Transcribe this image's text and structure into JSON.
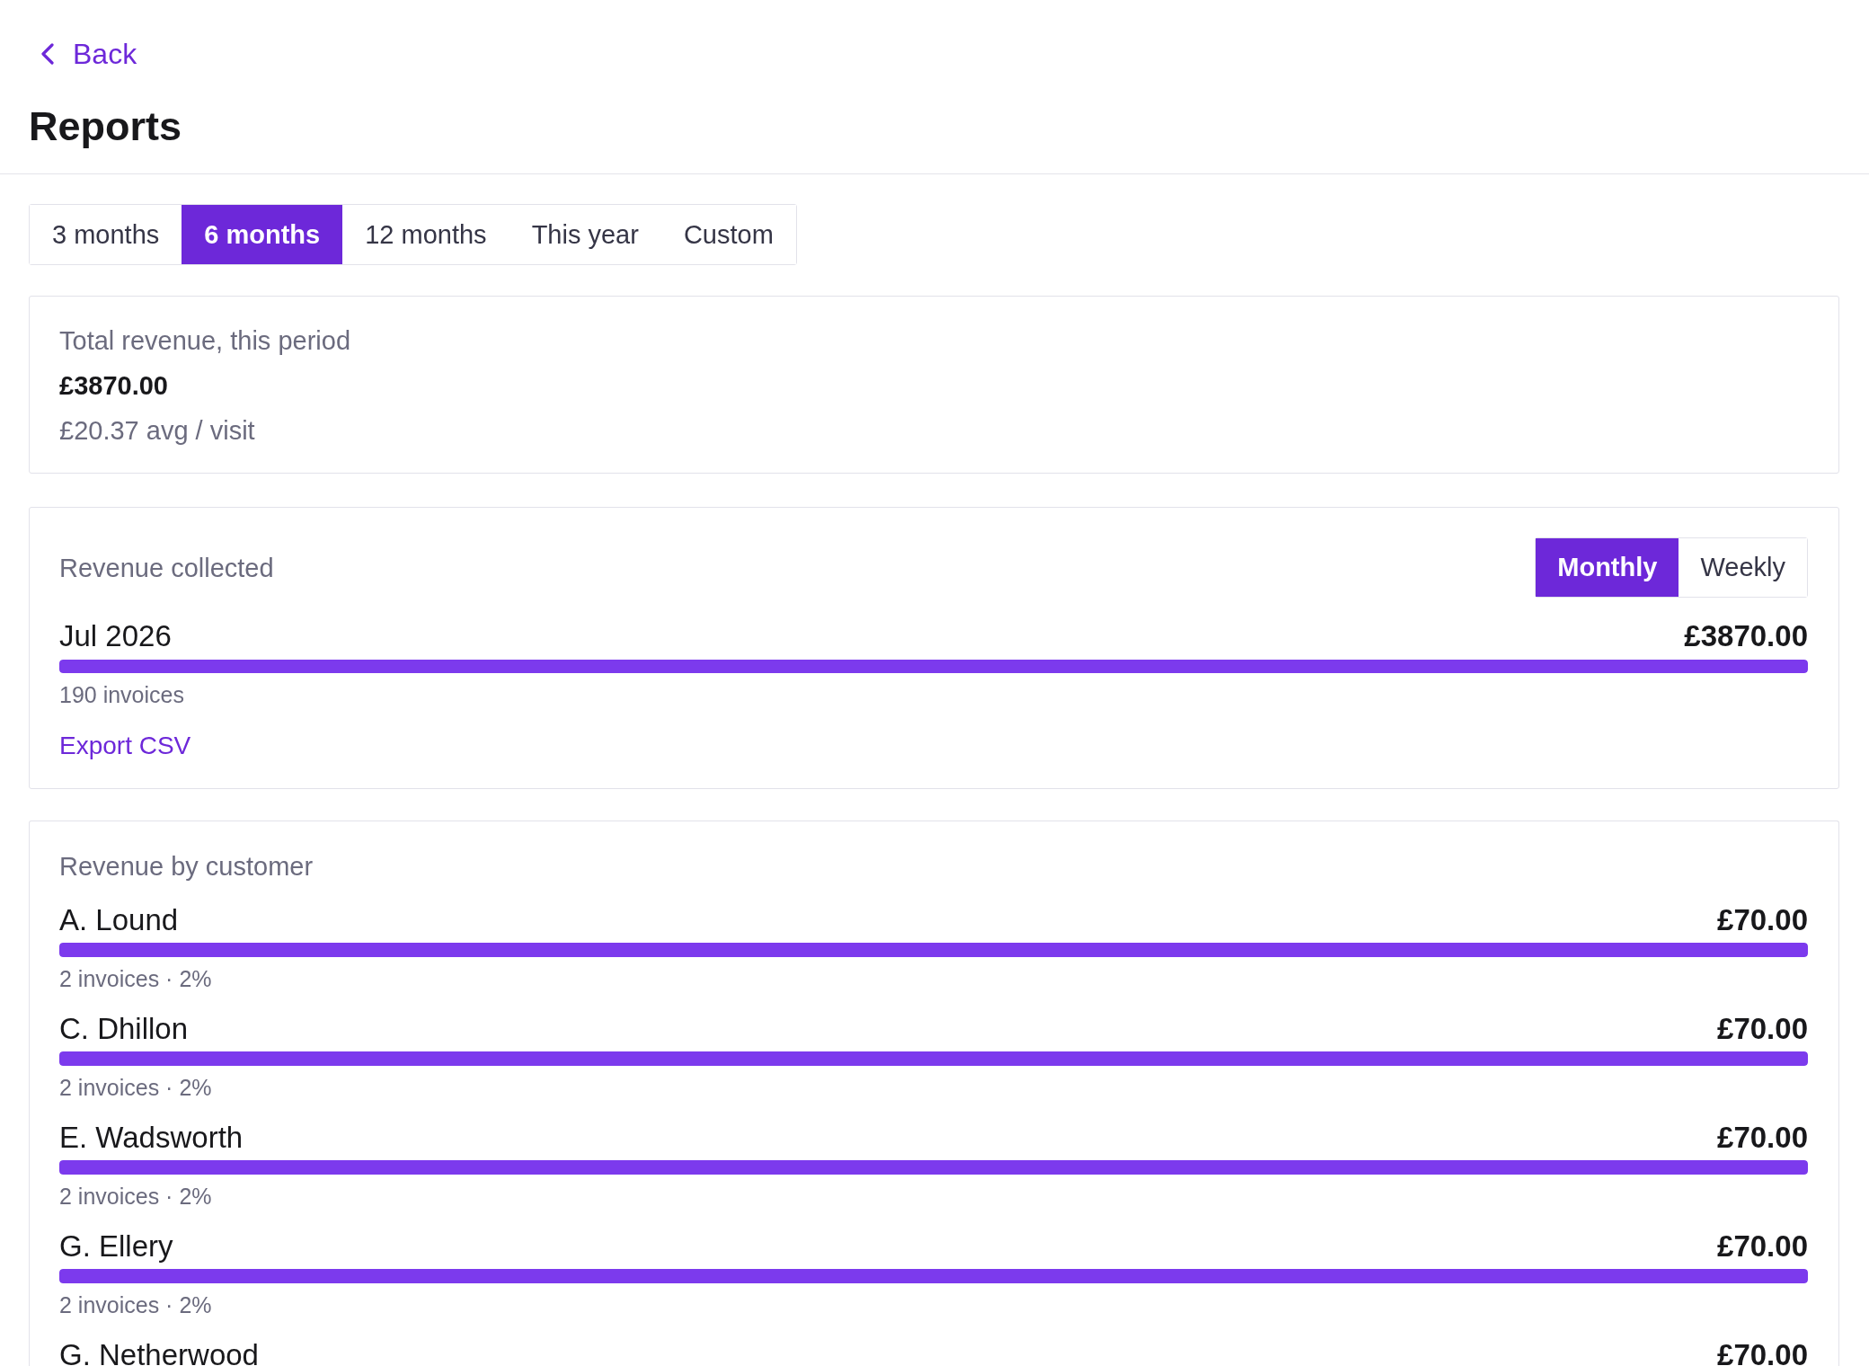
{
  "back_link": {
    "label": "Back"
  },
  "page_title": "Reports",
  "period_tabs": [
    {
      "label": "3 months",
      "selected": false
    },
    {
      "label": "6 months",
      "selected": true
    },
    {
      "label": "12 months",
      "selected": false
    },
    {
      "label": "This year",
      "selected": false
    },
    {
      "label": "Custom",
      "selected": false
    }
  ],
  "summary_card": {
    "label": "Total revenue, this period",
    "total": "£3870.00",
    "average": "£20.37 avg / visit"
  },
  "revenue_collected": {
    "title": "Revenue collected",
    "granularity_toggle": [
      {
        "label": "Monthly",
        "selected": true
      },
      {
        "label": "Weekly",
        "selected": false
      }
    ],
    "periods": [
      {
        "label": "Jul 2026",
        "amount": "£3870.00",
        "level": 1,
        "invoices": "190 invoices"
      }
    ],
    "export_link": "Export CSV"
  },
  "revenue_by_customer": {
    "title": "Revenue by customer",
    "customers": [
      {
        "name": "A. Lound",
        "amount": "£70.00",
        "level": 1,
        "details": "2 invoices · 2%"
      },
      {
        "name": "C. Dhillon",
        "amount": "£70.00",
        "level": 1,
        "details": "2 invoices · 2%"
      },
      {
        "name": "E. Wadsworth",
        "amount": "£70.00",
        "level": 1,
        "details": "2 invoices · 2%"
      },
      {
        "name": "G. Ellery",
        "amount": "£70.00",
        "level": 1,
        "details": "2 invoices · 2%"
      },
      {
        "name": "G. Netherwood",
        "amount": "£70.00"
      }
    ]
  }
}
